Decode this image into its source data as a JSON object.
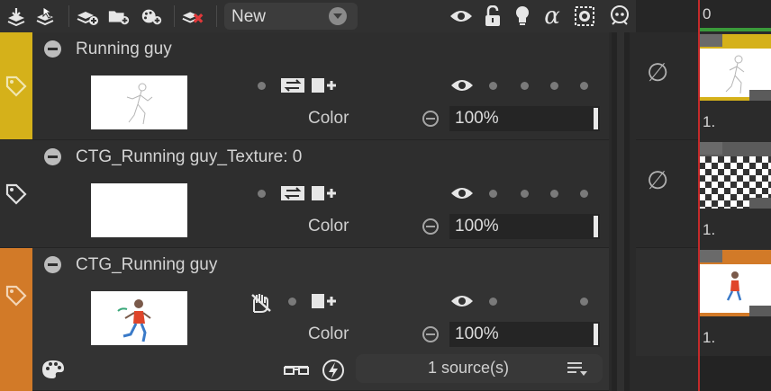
{
  "toolbar": {
    "dropdown_value": "New",
    "icons_left": [
      "import-layers-icon",
      "select-layers-icon",
      "add-layer-icon",
      "add-folder-icon",
      "add-effect-icon",
      "delete-layer-icon"
    ],
    "icons_right": [
      "visibility-icon",
      "lock-icon",
      "light-icon",
      "alpha-icon",
      "selection-icon",
      "onion-skin-icon"
    ]
  },
  "layers": [
    {
      "name": "Running guy",
      "tag_color": "#d5b11a",
      "blend_label": "Color",
      "opacity": "100%",
      "thumbnail": "running-figure-sketch"
    },
    {
      "name": "CTG_Running guy_Texture: 0",
      "tag_color": "",
      "blend_label": "Color",
      "opacity": "100%",
      "thumbnail": "blank-white"
    },
    {
      "name": "CTG_Running guy",
      "tag_color": "#d27a28",
      "blend_label": "Color",
      "opacity": "100%",
      "thumbnail": "running-figure-color",
      "sources": "1 source(s)"
    }
  ],
  "timeline": {
    "current_frame": "0",
    "cells": [
      {
        "frame": "1.",
        "accent": "#d5b11a"
      },
      {
        "frame": "1.",
        "accent": "checker"
      },
      {
        "frame": "1.",
        "accent": "#d27a28"
      }
    ],
    "empty_symbol": "∅"
  },
  "colors": {
    "accent_yellow": "#d5b11a",
    "accent_orange": "#d27a28",
    "playhead_red": "#c42a2a",
    "range_green": "#3a9a3a"
  }
}
